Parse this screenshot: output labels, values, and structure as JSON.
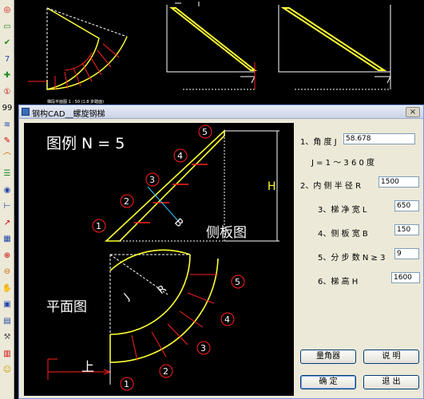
{
  "toolbar": {
    "tools": [
      {
        "icon": "target-icon",
        "glyph": "◎",
        "color": "#cc0000"
      },
      {
        "icon": "green-rect-icon",
        "glyph": "▭",
        "color": "#1f8a1f"
      },
      {
        "icon": "checkmark-icon",
        "glyph": "✔",
        "color": "#1f8a1f"
      },
      {
        "icon": "number-7-icon",
        "glyph": "7",
        "color": "#2244aa"
      },
      {
        "icon": "plus-icon",
        "glyph": "✚",
        "color": "#1f8a1f"
      },
      {
        "icon": "number-1-circle-icon",
        "glyph": "①",
        "color": "#cc0000"
      },
      {
        "icon": "number-99-icon",
        "glyph": "99",
        "color": "#000000"
      },
      {
        "icon": "layers-icon",
        "glyph": "≋",
        "color": "#2244aa"
      },
      {
        "icon": "pencil-icon",
        "glyph": "✎",
        "color": "#cc0000"
      },
      {
        "icon": "curve-icon",
        "glyph": "⌒",
        "color": "#cc6600"
      },
      {
        "icon": "list-icon",
        "glyph": "☰",
        "color": "#1f8a1f"
      },
      {
        "icon": "eye-icon",
        "glyph": "◉",
        "color": "#2244aa"
      },
      {
        "icon": "measure-icon",
        "glyph": "⊢",
        "color": "#2244aa"
      },
      {
        "icon": "graph-icon",
        "glyph": "↗",
        "color": "#cc0000"
      },
      {
        "icon": "grid-icon",
        "glyph": "▦",
        "color": "#2244aa"
      },
      {
        "icon": "zoom-in-icon",
        "glyph": "⊕",
        "color": "#cc0000"
      },
      {
        "icon": "zoom-out-icon",
        "glyph": "⊖",
        "color": "#cc6600"
      },
      {
        "icon": "hand-icon",
        "glyph": "✋",
        "color": "#cc6600"
      },
      {
        "icon": "window-icon",
        "glyph": "▣",
        "color": "#2244aa"
      },
      {
        "icon": "document-icon",
        "glyph": "▤",
        "color": "#2244aa"
      },
      {
        "icon": "wrench-icon",
        "glyph": "⚒",
        "color": "#555555"
      },
      {
        "icon": "book-icon",
        "glyph": "▥",
        "color": "#cc0000"
      },
      {
        "icon": "smiley-icon",
        "glyph": "☺",
        "color": "#cc9900"
      }
    ]
  },
  "background": {
    "status_text": "梯段平面图  1 : 50 (1.8 步踏面)"
  },
  "dialog": {
    "title": "钢构CAD__螺旋钢梯",
    "close_label": "×",
    "diagram": {
      "legend_title": "图例 N = 5",
      "side_view_label": "侧板图",
      "plan_view_label": "平面图",
      "up_label": "上",
      "height_label": "H",
      "width_label": "B",
      "angle_label": "J",
      "radius_label": "R",
      "side_step_numbers": [
        "1",
        "2",
        "3",
        "4",
        "5"
      ],
      "plan_step_numbers": [
        "1",
        "2",
        "3",
        "4",
        "5"
      ]
    },
    "form": {
      "angle_label": "1、角 度 J",
      "angle_value": "58.678",
      "angle_range": "J = 1 ～ 3 6 0 度",
      "inner_radius_label": "2、内 侧 半 径 R",
      "inner_radius_value": "1500",
      "net_width_label": "3、梯 净 宽 L",
      "net_width_value": "650",
      "side_plate_width_label": "4、侧 板 宽 B",
      "side_plate_width_value": "150",
      "steps_label": "5、分 步 数 N ≥ 3",
      "steps_value": "9",
      "height_label": "6、梯 高 H",
      "height_value": "1600"
    },
    "buttons": {
      "protractor": "量角器",
      "help": "说    明",
      "ok": "确    定",
      "exit": "退    出"
    }
  },
  "colors": {
    "cad_yellow": "#ffff33",
    "cad_red": "#ff2020",
    "cad_white": "#ffffff",
    "cad_cyan": "#33ccff"
  }
}
